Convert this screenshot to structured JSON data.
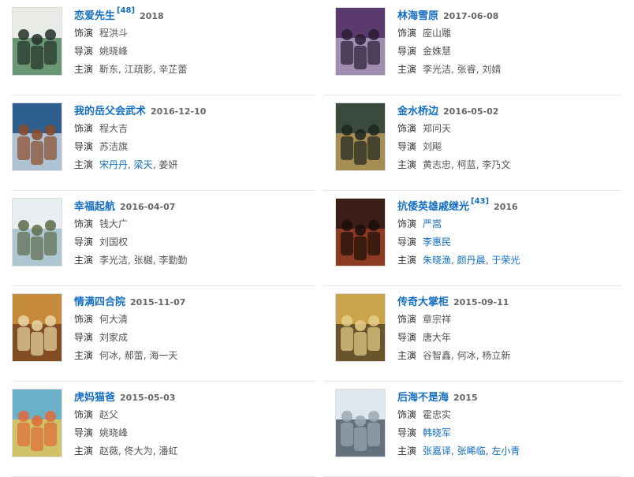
{
  "labels": {
    "role": "饰演",
    "director": "导演",
    "cast": "主演"
  },
  "items": [
    {
      "title": "恋爱先生",
      "ref": "[48]",
      "date": "2018",
      "role": [
        {
          "t": "程洪斗",
          "link": false
        }
      ],
      "director": [
        {
          "t": "姚晓峰",
          "link": false
        }
      ],
      "cast": [
        {
          "t": "靳东",
          "link": false
        },
        {
          "t": "江疏影",
          "link": false
        },
        {
          "t": "辛芷蕾",
          "link": false
        }
      ],
      "colors": [
        "#e9ece6",
        "#3e7a4c",
        "#24302a"
      ]
    },
    {
      "title": "林海雪原",
      "ref": "",
      "date": "2017-06-08",
      "role": [
        {
          "t": "座山雕",
          "link": false
        }
      ],
      "director": [
        {
          "t": "金姝慧",
          "link": false
        }
      ],
      "cast": [
        {
          "t": "李光洁",
          "link": false
        },
        {
          "t": "张睿",
          "link": false
        },
        {
          "t": "刘婧",
          "link": false
        }
      ],
      "colors": [
        "#5b3a6e",
        "#b8a9c9",
        "#2a1d35"
      ]
    },
    {
      "title": "我的岳父会武术",
      "ref": "",
      "date": "2016-12-10",
      "role": [
        {
          "t": "程大吉",
          "link": false
        }
      ],
      "director": [
        {
          "t": "苏洁旗",
          "link": false
        }
      ],
      "cast": [
        {
          "t": "宋丹丹",
          "link": true
        },
        {
          "t": "梁天",
          "link": true
        },
        {
          "t": "姜妍",
          "link": false
        }
      ],
      "colors": [
        "#2f5f8e",
        "#d9e3ea",
        "#8a4a2a"
      ]
    },
    {
      "title": "金水桥边",
      "ref": "",
      "date": "2016-05-02",
      "role": [
        {
          "t": "郑问天",
          "link": false
        }
      ],
      "director": [
        {
          "t": "刘飚",
          "link": false
        }
      ],
      "cast": [
        {
          "t": "黄志忠",
          "link": false
        },
        {
          "t": "柯蓝",
          "link": false
        },
        {
          "t": "李乃文",
          "link": false
        }
      ],
      "colors": [
        "#3a4a3e",
        "#c9a45c",
        "#1e2420"
      ]
    },
    {
      "title": "幸福起航",
      "ref": "",
      "date": "2016-04-07",
      "role": [
        {
          "t": "钱大广",
          "link": false
        }
      ],
      "director": [
        {
          "t": "刘国权",
          "link": false
        }
      ],
      "cast": [
        {
          "t": "李光洁",
          "link": false
        },
        {
          "t": "张樾",
          "link": false
        },
        {
          "t": "李勤勤",
          "link": false
        }
      ],
      "colors": [
        "#e8eef0",
        "#9bb8c4",
        "#5c6b4a"
      ]
    },
    {
      "title": "抗倭英雄戚继光",
      "ref": "[43]",
      "date": "2016",
      "role": [
        {
          "t": "严嵩",
          "link": true
        }
      ],
      "director": [
        {
          "t": "李惠民",
          "link": true
        }
      ],
      "cast": [
        {
          "t": "朱晓渔",
          "link": true
        },
        {
          "t": "颜丹晨",
          "link": true
        },
        {
          "t": "于荣光",
          "link": true
        }
      ],
      "colors": [
        "#3b1f16",
        "#a8442a",
        "#1a0f0a"
      ]
    },
    {
      "title": "情满四合院",
      "ref": "",
      "date": "2015-11-07",
      "role": [
        {
          "t": "何大清",
          "link": false
        }
      ],
      "director": [
        {
          "t": "刘家成",
          "link": false
        }
      ],
      "cast": [
        {
          "t": "何冰",
          "link": false
        },
        {
          "t": "郝蕾",
          "link": false
        },
        {
          "t": "海一天",
          "link": false
        }
      ],
      "colors": [
        "#c58a3a",
        "#6a3a1e",
        "#e9d6a6"
      ]
    },
    {
      "title": "传奇大掌柜",
      "ref": "",
      "date": "2015-09-11",
      "role": [
        {
          "t": "章宗祥",
          "link": false
        }
      ],
      "director": [
        {
          "t": "唐大年",
          "link": false
        }
      ],
      "cast": [
        {
          "t": "谷智鑫",
          "link": false
        },
        {
          "t": "何冰",
          "link": false
        },
        {
          "t": "杨立新",
          "link": false
        }
      ],
      "colors": [
        "#c9a44a",
        "#4a3a22",
        "#e6d08a"
      ]
    },
    {
      "title": "虎妈猫爸",
      "ref": "",
      "date": "2015-05-03",
      "role": [
        {
          "t": "赵父",
          "link": false
        }
      ],
      "director": [
        {
          "t": "姚晓峰",
          "link": false
        }
      ],
      "cast": [
        {
          "t": "赵薇",
          "link": false
        },
        {
          "t": "佟大为",
          "link": false
        },
        {
          "t": "潘虹",
          "link": false
        }
      ],
      "colors": [
        "#6ab0c8",
        "#f2c84a",
        "#e06a3a"
      ]
    },
    {
      "title": "后海不是海",
      "ref": "",
      "date": "2015",
      "role": [
        {
          "t": "霍忠实",
          "link": false
        }
      ],
      "director": [
        {
          "t": "韩晓军",
          "link": true
        }
      ],
      "cast": [
        {
          "t": "张嘉译",
          "link": true
        },
        {
          "t": "张睎临",
          "link": true
        },
        {
          "t": "左小青",
          "link": true
        }
      ],
      "colors": [
        "#dfe6ec",
        "#3a4a5a",
        "#9aa8b4"
      ]
    }
  ]
}
